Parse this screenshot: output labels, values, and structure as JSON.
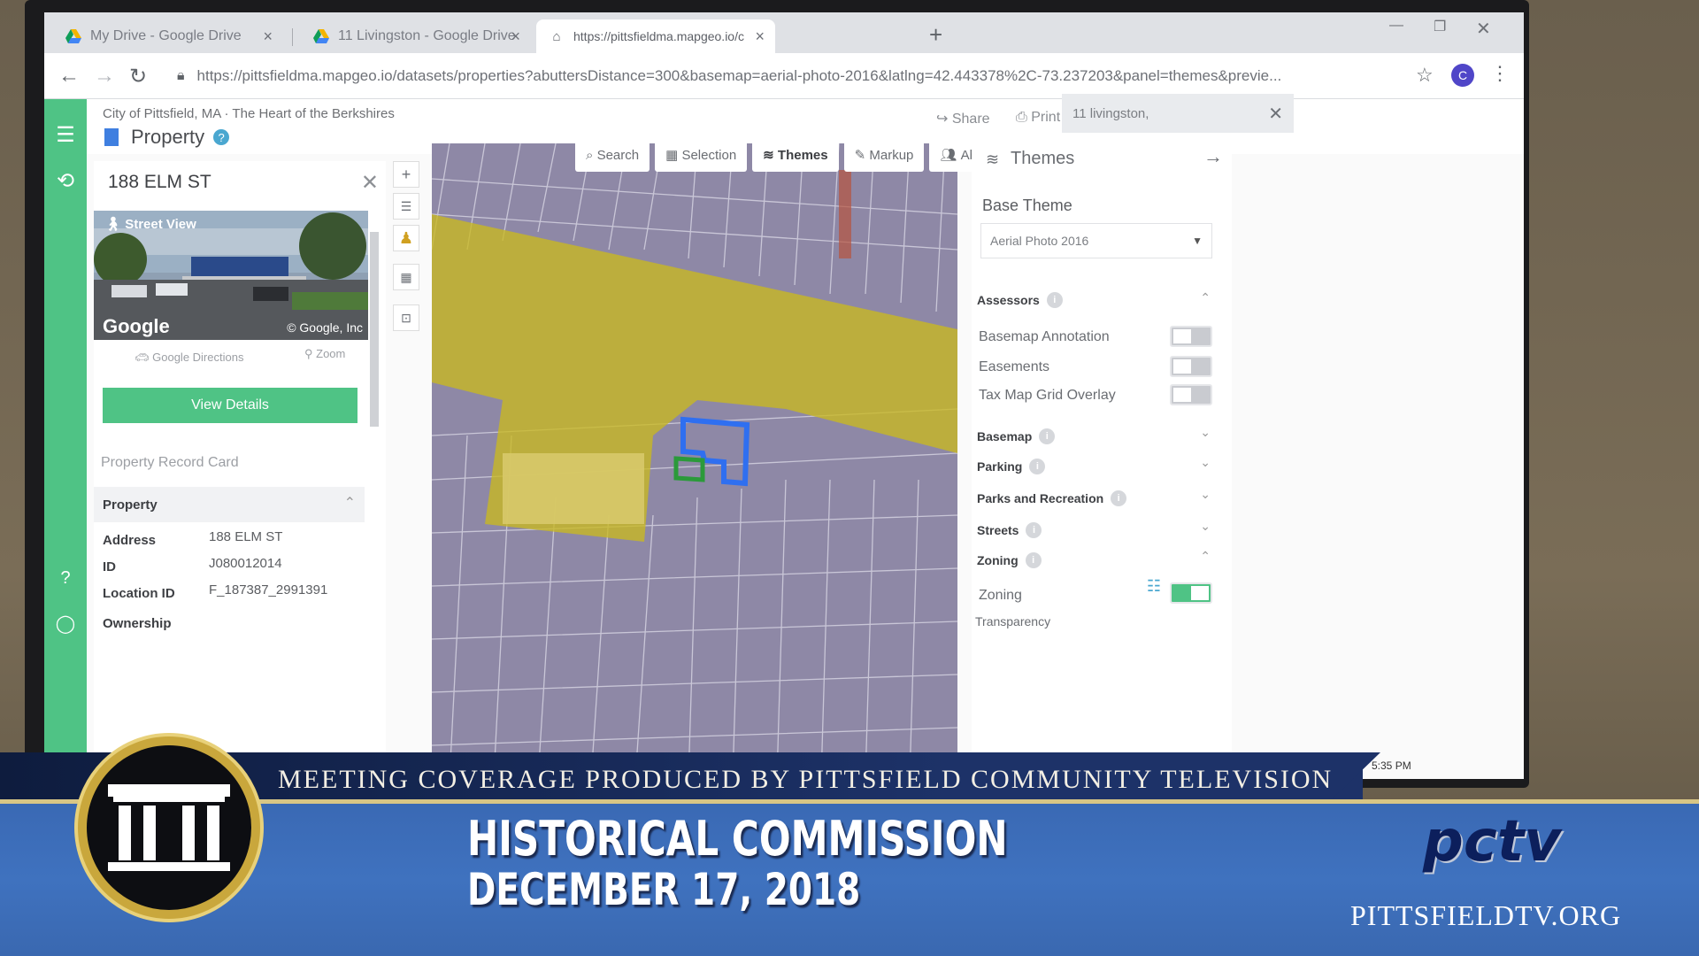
{
  "browser": {
    "tabs": [
      {
        "label": "My Drive - Google Drive",
        "icon": "google-drive-icon"
      },
      {
        "label": "11 Livingston - Google Drive",
        "icon": "google-drive-icon"
      },
      {
        "label": "https://pittsfieldma.mapgeo.io/c",
        "icon": "home-icon"
      }
    ],
    "url": "https://pittsfieldma.mapgeo.io/datasets/properties?abuttersDistance=300&basemap=aerial-photo-2016&latlng=42.443378%2C-73.237203&panel=themes&previe...",
    "profile_initial": "C"
  },
  "app": {
    "breadcrumb": "City of Pittsfield, MA · The Heart of the Berkshires",
    "title": "Property",
    "share_label": "Share",
    "print_label": "Print",
    "search_value": "11 livingston,"
  },
  "property_panel": {
    "address_title": "188 ELM ST",
    "street_view_label": "Street View",
    "google_logo": "Google",
    "google_copyright": "© Google, Inc",
    "directions_label": "Google Directions",
    "zoom_label": "Zoom",
    "view_details_label": "View Details",
    "record_card_label": "Property Record Card",
    "property_section": "Property",
    "fields": [
      {
        "label": "Address",
        "value": "188 ELM ST"
      },
      {
        "label": "ID",
        "value": "J080012014"
      },
      {
        "label": "Location ID",
        "value": "F_187387_2991391"
      }
    ],
    "ownership_section": "Ownership"
  },
  "map_tabs": [
    {
      "label": "Search",
      "icon": "search-icon"
    },
    {
      "label": "Selection",
      "icon": "grid-icon"
    },
    {
      "label": "Themes",
      "icon": "layers-icon",
      "active": true
    },
    {
      "label": "Markup",
      "icon": "pencil-icon"
    },
    {
      "label": "Abutters",
      "icon": "users-icon"
    }
  ],
  "themes": {
    "title": "Themes",
    "base_theme_label": "Base Theme",
    "base_theme_value": "Aerial Photo 2016",
    "groups": [
      {
        "name": "Assessors",
        "expanded": true
      },
      {
        "name": "Basemap",
        "expanded": false
      },
      {
        "name": "Parking",
        "expanded": false
      },
      {
        "name": "Parks and Recreation",
        "expanded": false
      },
      {
        "name": "Streets",
        "expanded": false
      },
      {
        "name": "Zoning",
        "expanded": true
      }
    ],
    "assessor_layers": [
      {
        "name": "Basemap Annotation",
        "on": false
      },
      {
        "name": "Easements",
        "on": false
      },
      {
        "name": "Tax Map Grid Overlay",
        "on": false
      }
    ],
    "zoning_layer": {
      "name": "Zoning",
      "on": true
    },
    "transparency_label": "Transparency"
  },
  "tray": {
    "time": "5:35 PM"
  },
  "broadcast": {
    "coverage_text": "MEETING COVERAGE PRODUCED BY PITTSFIELD COMMUNITY TELEVISION",
    "event_title": "HISTORICAL COMMISSION",
    "event_date": "DECEMBER 17, 2018",
    "logo_text": "pctv",
    "website": "PITTSFIELDTV.ORG"
  },
  "colors": {
    "accent_green": "#4fc385",
    "zoning_yellow": "#c9b820",
    "parcel_blue": "#2f6ff0",
    "band_navy": "#1d3268",
    "band_blue": "#3f72bf"
  }
}
